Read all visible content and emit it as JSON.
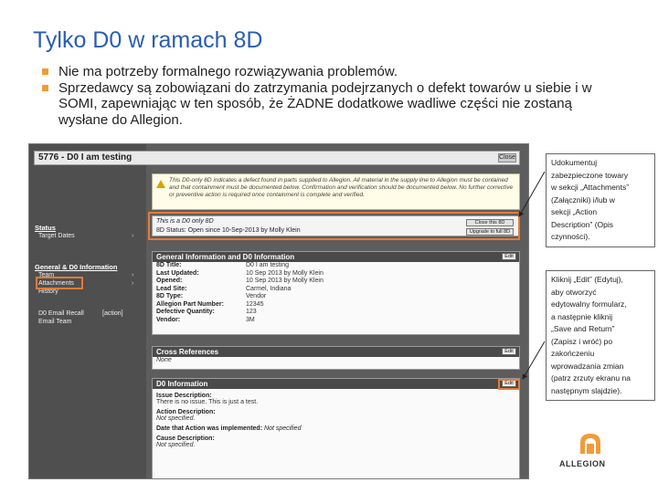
{
  "slide": {
    "title": "Tylko D0 w ramach 8D",
    "bullets": [
      "Nie ma potrzeby formalnego rozwiązywania problemów.",
      "Sprzedawcy są zobowiązani do zatrzymania podejrzanych o defekt towarów u siebie i w SOMI, zapewniając w ten sposób, że ŻADNE dodatkowe wadliwe części nie zostaną wysłane do Allegion."
    ]
  },
  "screenshot": {
    "title": "5776 - D0 I am testing",
    "close_label": "Close",
    "warning": "This D0-only 8D indicates a defect found in parts supplied to Allegion. All material in the supply line to Allegion must be contained and that containment must be documented below. Confirmation and verification should be documented below. No further corrective or preventive action is required once containment is complete and verified.",
    "sidebar": {
      "status_label": "Status",
      "target_dates": "Target Dates",
      "general_label": "General & D0 Information",
      "team": "Team",
      "attachments": "Attachments",
      "history": "History",
      "d0_email_recall": "D0 Email Recall",
      "d0_email_recall_action": "[action]",
      "email_team": "Email Team"
    },
    "banner": {
      "line1": "This is a D0 only 8D",
      "line2": "8D Status: Open since 10-Sep-2013 by Molly Klein",
      "btn1": "Close this 8D",
      "btn2": "Upgrade to full 8D"
    },
    "general": {
      "header": "General Information and D0 Information",
      "edit": "Edit",
      "rows": [
        {
          "k": "8D Title:",
          "v": "D0 I am testing"
        },
        {
          "k": "Last Updated:",
          "v": "10 Sep 2013 by Molly Klein"
        },
        {
          "k": "Opened:",
          "v": "10 Sep 2013 by Molly Klein"
        },
        {
          "k": "Lead Site:",
          "v": "Carmel, Indiana"
        },
        {
          "k": "8D Type:",
          "v": "Vendor"
        },
        {
          "k": "Allegion Part Number:",
          "v": "12345"
        },
        {
          "k": "Defective Quantity:",
          "v": "123"
        },
        {
          "k": "Vendor:",
          "v": "3M"
        }
      ]
    },
    "crossref": {
      "header": "Cross References",
      "edit": "Edit",
      "value": "None"
    },
    "d0": {
      "header": "D0 Information",
      "edit": "Edit",
      "issue_label": "Issue Description:",
      "issue_value": "There is no issue. This is just a test.",
      "action_label": "Action Description:",
      "action_value": "Not specified.",
      "date_label": "Date that Action was implemented:",
      "date_value": "Not specified",
      "cause_label": "Cause Description:",
      "cause_value": "Not specified."
    }
  },
  "callouts": {
    "top": [
      "Udokumentuj",
      "zabezpieczone towary",
      "w sekcji „Attachments”",
      "(Załączniki) i/lub  w",
      "sekcji „Action",
      "Description” (Opis",
      "czynności)."
    ],
    "bottom": [
      "Kliknij „Edit” (Edytuj),",
      "aby otworzyć",
      "edytowalny formularz,",
      "a następnie kliknij",
      "„Save and Return”",
      "(Zapisz i wróć) po",
      "zakończeniu",
      "wprowadzania zmian",
      "(patrz zrzuty ekranu na",
      "następnym slajdzie)."
    ]
  },
  "brand": {
    "name": "ALLEGION",
    "accent": "#f29b38",
    "highlight": "#e87a35",
    "title_color": "#2a5db0"
  }
}
